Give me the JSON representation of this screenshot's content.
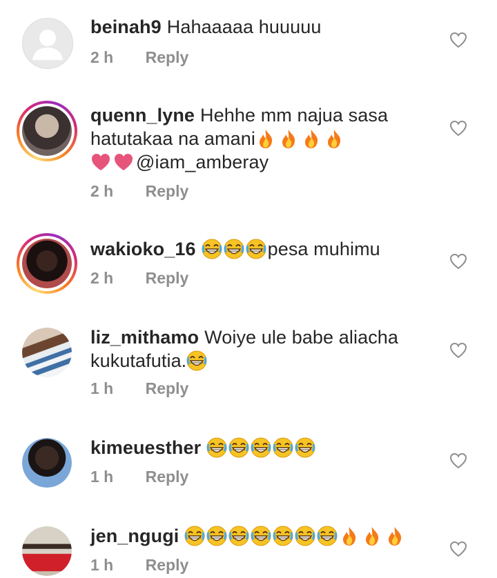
{
  "comments": [
    {
      "username": "beinah9",
      "text": "Hahaaaaa huuuuu",
      "time": "2 h",
      "reply": "Reply",
      "avatar": "default-avatar-icon"
    },
    {
      "username": "quenn_lyne",
      "text_line1": "Hehhe mm najua sasa",
      "text_line2": "hatutakaa na amani",
      "mention": "@iam_amberay",
      "time": "2 h",
      "reply": "Reply",
      "emojis": [
        "fire-emoji",
        "fire-emoji",
        "fire-emoji",
        "fire-emoji",
        "heart-emoji",
        "heart-emoji"
      ]
    },
    {
      "username": "wakioko_16",
      "text": "pesa muhimu",
      "time": "2 h",
      "reply": "Reply",
      "emojis": [
        "laugh-emoji",
        "laugh-emoji",
        "laugh-emoji"
      ]
    },
    {
      "username": "liz_mithamo",
      "text_line1": "Woiye ule babe aliacha",
      "text_line2": "kukutafutia.",
      "time": "1 h",
      "reply": "Reply",
      "emojis": [
        "laugh-emoji"
      ]
    },
    {
      "username": "kimeuesther",
      "time": "1 h",
      "reply": "Reply",
      "emojis": [
        "laugh-emoji",
        "laugh-emoji",
        "laugh-emoji",
        "laugh-emoji",
        "laugh-emoji"
      ]
    },
    {
      "username": "jen_ngugi",
      "time": "1 h",
      "reply": "Reply",
      "emojis": [
        "laugh-emoji",
        "laugh-emoji",
        "laugh-emoji",
        "laugh-emoji",
        "laugh-emoji",
        "laugh-emoji",
        "laugh-emoji",
        "fire-emoji",
        "fire-emoji",
        "fire-emoji"
      ]
    }
  ],
  "colors": {
    "text": "#262626",
    "meta": "#8e8e8e",
    "heart_outline": "#8e8e8e",
    "fire": "#f57a1a",
    "laugh": "#f7c325",
    "heart_emoji": "#e7547b"
  }
}
